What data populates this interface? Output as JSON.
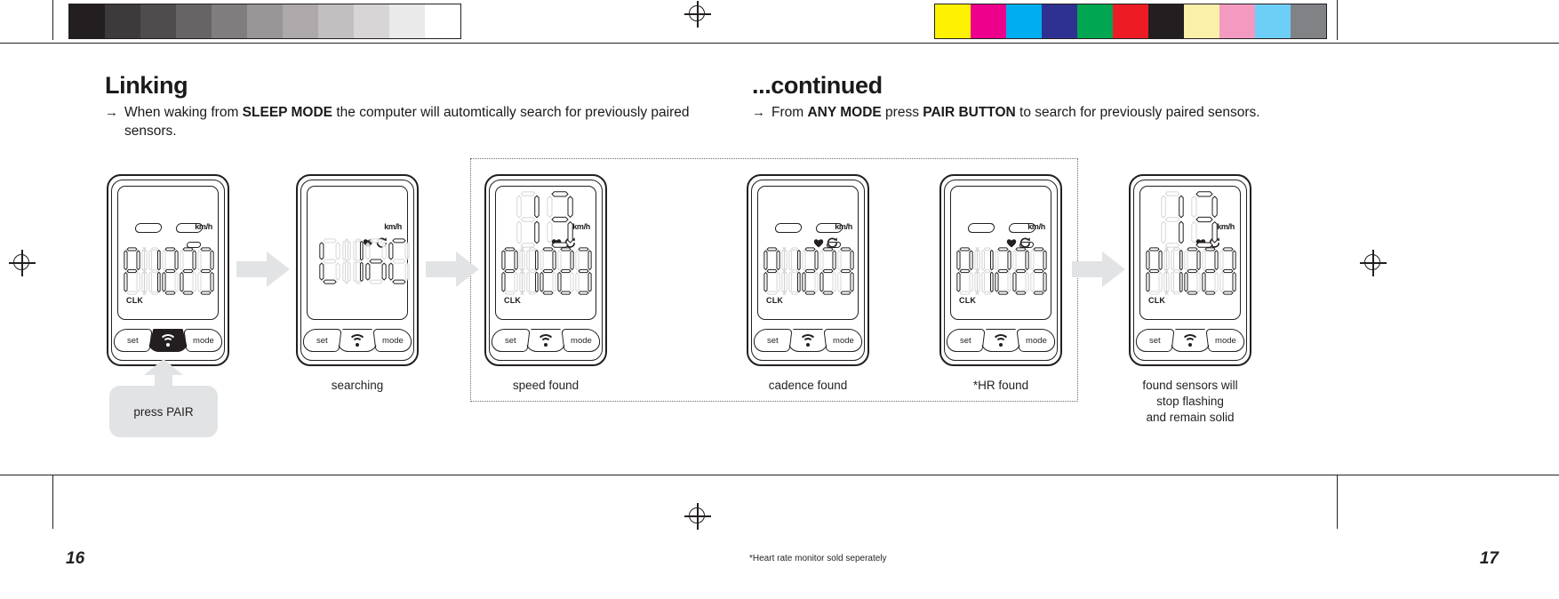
{
  "document": {
    "page_left": "16",
    "page_right": "17",
    "footnote": "*Heart rate monitor sold seperately"
  },
  "left_section": {
    "heading": "Linking",
    "bullet_arrow": "→",
    "bullet": {
      "pre": "When waking from ",
      "bold1": "SLEEP MODE",
      "post": " the computer will automtically search for previously paired sensors."
    }
  },
  "right_section": {
    "heading": "...continued",
    "bullet_arrow": "→",
    "bullet": {
      "pre": "From ",
      "bold1": "ANY MODE",
      "mid": " press ",
      "bold2": "PAIR BUTTON",
      "post": " to search for previously paired sensors."
    }
  },
  "callout": {
    "label": "press PAIR"
  },
  "devices": [
    {
      "id": "device-sleep",
      "caption": "",
      "button_set": "set",
      "button_mode": "mode",
      "pair_button_state": "pressed",
      "screen": {
        "kmh": "km/h",
        "clk": "CLK",
        "digits": "P 1223",
        "heart_icon": false,
        "cadence_icon": false,
        "pill_left": true,
        "pill_right": true,
        "pill_small": true
      }
    },
    {
      "id": "device-searching",
      "caption": "searching",
      "button_set": "set",
      "button_mode": "mode",
      "pair_button_state": "normal",
      "screen": {
        "kmh": "km/h",
        "clk": "",
        "digits": "L InC",
        "heart_icon": true,
        "cadence_icon": true,
        "pill_left": false,
        "pill_right": false,
        "pill_small": false
      }
    },
    {
      "id": "device-speed-found",
      "caption": "speed found",
      "button_set": "set",
      "button_mode": "mode",
      "pair_button_state": "normal",
      "screen": {
        "kmh": "km/h",
        "clk": "CLK",
        "digits": "P 1223",
        "heart_icon": true,
        "cadence_icon": true,
        "pill_left": false,
        "pill_right": false,
        "pill_small": false,
        "big_speed": true
      }
    },
    {
      "id": "device-cadence-found",
      "caption": "cadence found",
      "button_set": "set",
      "button_mode": "mode",
      "pair_button_state": "normal",
      "screen": {
        "kmh": "km/h",
        "clk": "CLK",
        "digits": "P 1223",
        "heart_icon": true,
        "cadence_icon": true,
        "pill_left": true,
        "pill_right": true,
        "pill_small": true
      }
    },
    {
      "id": "device-hr-found",
      "caption": "*HR found",
      "button_set": "set",
      "button_mode": "mode",
      "pair_button_state": "normal",
      "screen": {
        "kmh": "km/h",
        "clk": "CLK",
        "digits": "P 1223",
        "heart_icon": true,
        "cadence_icon": true,
        "pill_left": true,
        "pill_right": true,
        "pill_small": true
      }
    },
    {
      "id": "device-solid",
      "caption": "found sensors will\nstop flashing\nand remain solid",
      "button_set": "set",
      "button_mode": "mode",
      "pair_button_state": "normal",
      "screen": {
        "kmh": "km/h",
        "clk": "CLK",
        "digits": "P 1223",
        "heart_icon": true,
        "cadence_icon": true,
        "pill_left": false,
        "pill_right": false,
        "pill_small": false,
        "big_speed": true
      }
    }
  ],
  "captions": {
    "searching": "searching",
    "speed_found": "speed found",
    "cadence_found": "cadence found",
    "hr_found": "*HR found",
    "solid_line1": "found sensors will",
    "solid_line2": "stop flashing",
    "solid_line3": "and remain solid"
  },
  "prepress": {
    "grey_steps": [
      "#231f20",
      "#3d3a3b",
      "#4f4c4d",
      "#676465",
      "#807d7e",
      "#999697",
      "#ada9aa",
      "#c2bfc0",
      "#d7d5d5",
      "#ebeaea",
      "#ffffff"
    ],
    "color_patches": [
      "#fff200",
      "#ec008c",
      "#00aeef",
      "#2e3192",
      "#00a651",
      "#ed1c24",
      "#231f20",
      "#fbf0a8",
      "#f49ac1",
      "#6dcff6",
      "#808285"
    ]
  }
}
